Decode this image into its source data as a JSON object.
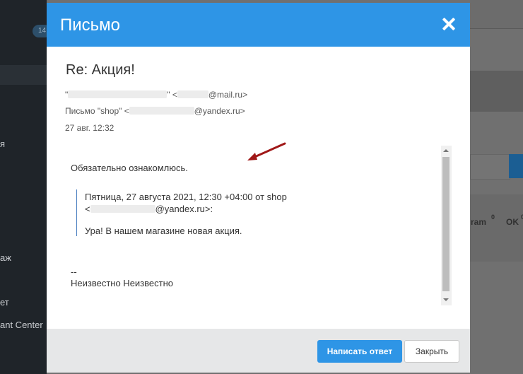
{
  "background": {
    "badge": "14",
    "sidebar_fragments": [
      "я",
      "аж",
      "ет",
      "ant Center"
    ],
    "right_fragments": [
      "ram",
      "0",
      "OK",
      "0"
    ]
  },
  "modal": {
    "title": "Письмо",
    "subject": "Re: Акция!",
    "from_prefix": "\"",
    "from_mid": "\" <",
    "from_suffix": "@mail.ru>",
    "to_prefix": "Письмо \"shop\" <",
    "to_suffix": "@yandex.ru>",
    "date": "27 авг. 12:32",
    "body": {
      "reply_text": "Обязательно ознакомлюсь.",
      "quote_header": "Пятница, 27 августа 2021, 12:30 +04:00 от shop",
      "quote_email_prefix": "<",
      "quote_email_suffix": "@yandex.ru>:",
      "quote_text": "Ура! В нашем магазине новая акция.",
      "signature_dash": "--",
      "signature_name": "Неизвестно Неизвестно"
    },
    "buttons": {
      "reply": "Написать ответ",
      "close": "Закрыть"
    }
  },
  "colors": {
    "header": "#2e95e6",
    "arrow": "#a01818"
  }
}
